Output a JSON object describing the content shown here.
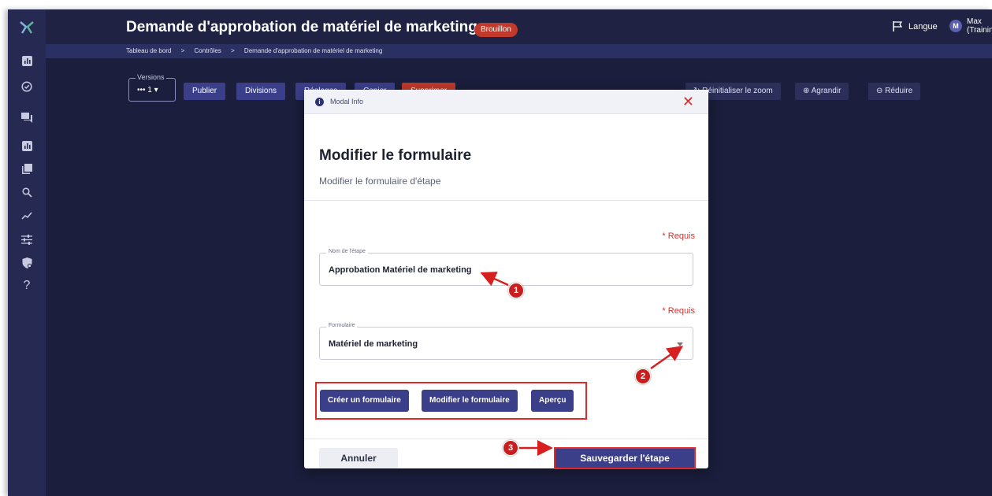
{
  "header": {
    "title": "Demande d'approbation de matériel de marketing",
    "status_badge": "Brouillon",
    "language_label": "Langue",
    "user_initial": "M",
    "user_name": "Max",
    "user_detail": "(TrainingFrench)"
  },
  "breadcrumb": {
    "items": [
      "Tableau de bord",
      "Contrôles",
      "Demande d'approbation de matériel de marketing"
    ],
    "separator": ">"
  },
  "toolbar": {
    "versions_label": "Versions",
    "versions_value": "••• 1 ▾",
    "buttons": [
      "Publier",
      "Divisions",
      "Réglages",
      "Copier",
      "Supprimer"
    ],
    "zoom_buttons": [
      "Réinitialiser le zoom",
      "Agrandir",
      "Réduire"
    ]
  },
  "modal": {
    "header_label": "Modal Info",
    "title": "Modifier le formulaire",
    "subtitle": "Modifier le formulaire d'étape",
    "required_label": "* Requis",
    "step_name_label": "Nom de l'étape",
    "step_name_value": "Approbation Matériel de marketing",
    "form_label": "Formulaire",
    "form_value": "Matériel de marketing",
    "create_form_button": "Créer un formulaire",
    "edit_form_button": "Modifier le formulaire",
    "preview_button": "Aperçu",
    "cancel_button": "Annuler",
    "save_button": "Sauvegarder l'étape"
  },
  "annotations": [
    "1",
    "2",
    "3"
  ],
  "colors": {
    "background": "#1b1e3c",
    "sidebar": "#262a52",
    "accent": "#3b3f8a",
    "danger": "#c0392b",
    "annotation": "#e02a2a"
  },
  "icons": {
    "sidebar": [
      "dashboard-icon",
      "check-circle-icon",
      "chat-icon",
      "report-icon",
      "library-icon",
      "search-icon",
      "trend-icon",
      "sliders-icon",
      "shield-icon",
      "help-icon"
    ]
  }
}
